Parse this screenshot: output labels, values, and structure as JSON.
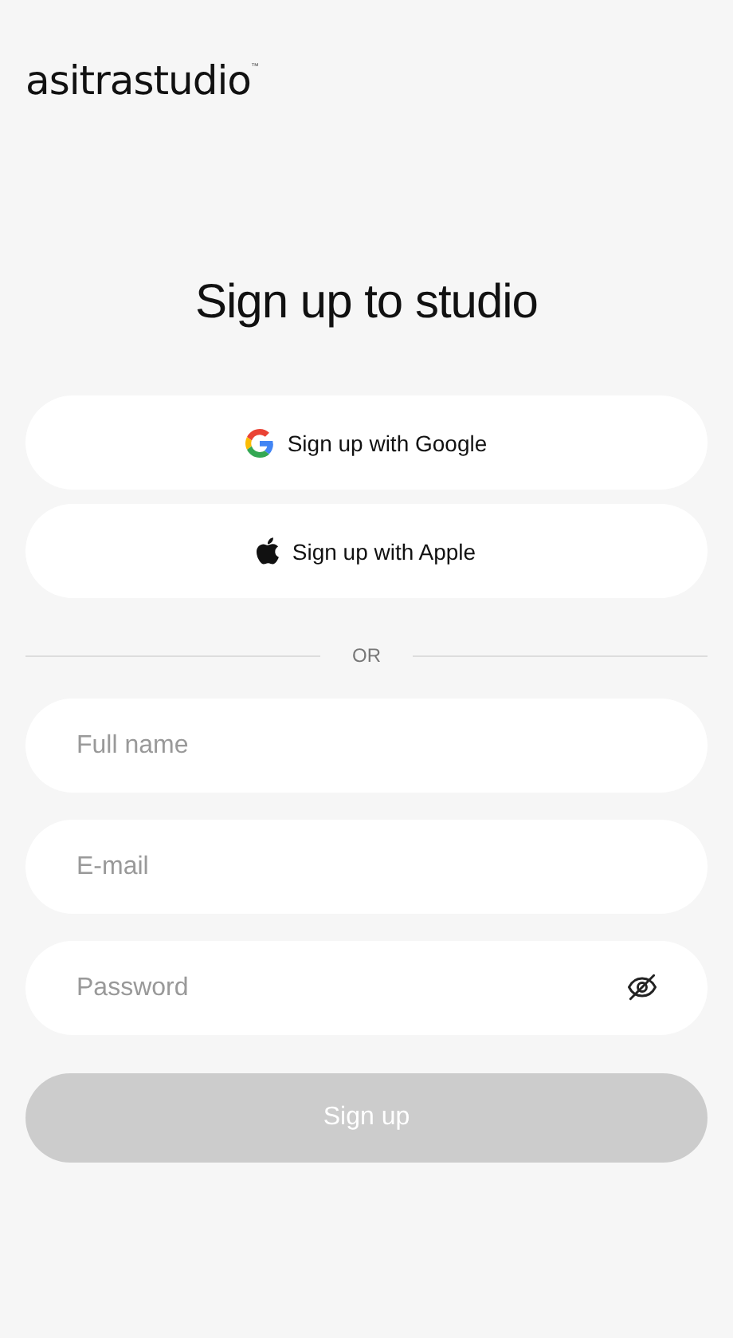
{
  "logo": {
    "text": "asitrastudio",
    "mark": "™"
  },
  "title": "Sign up to studio",
  "social_buttons": [
    {
      "kind": "google",
      "label": "Sign up with Google"
    },
    {
      "kind": "apple",
      "label": "Sign up with Apple"
    }
  ],
  "divider": "OR",
  "fields": [
    {
      "kind": "text",
      "placeholder": "Full name"
    },
    {
      "kind": "text",
      "placeholder": "E-mail"
    },
    {
      "kind": "password",
      "placeholder": "Password"
    }
  ],
  "submit": {
    "label": "Sign up",
    "disabled": true
  }
}
